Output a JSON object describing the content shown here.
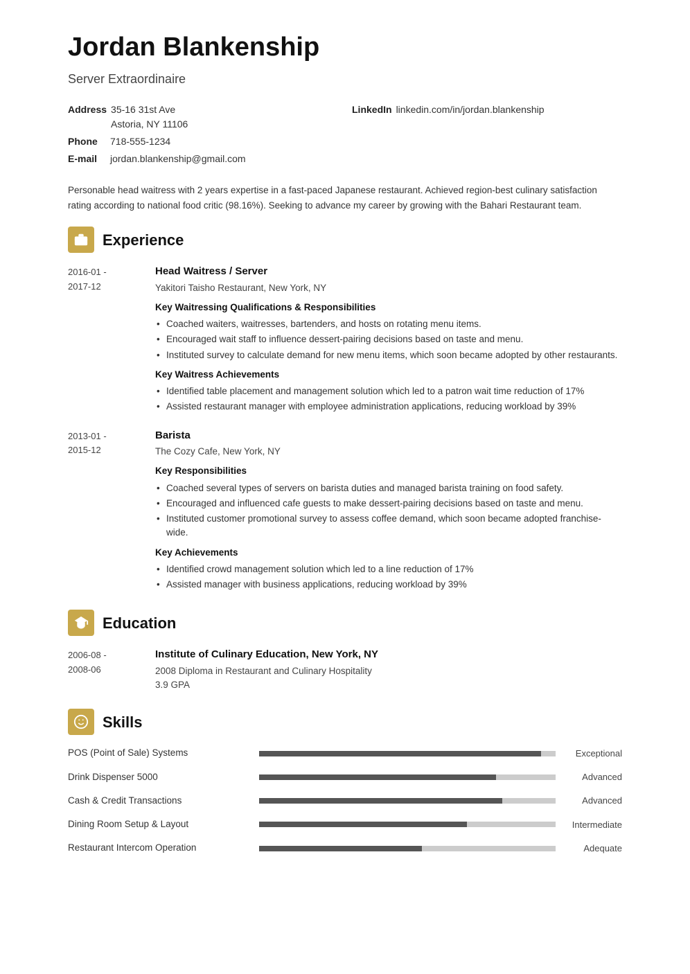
{
  "header": {
    "name": "Jordan Blankenship",
    "title": "Server Extraordinaire"
  },
  "contact": {
    "address_label": "Address",
    "address_line1": "35-16 31st Ave",
    "address_line2": "Astoria, NY 11106",
    "phone_label": "Phone",
    "phone": "718-555-1234",
    "email_label": "E-mail",
    "email": "jordan.blankenship@gmail.com",
    "linkedin_label": "LinkedIn",
    "linkedin": "linkedin.com/in/jordan.blankenship"
  },
  "summary": "Personable head waitress with 2 years expertise in a fast-paced Japanese restaurant. Achieved region-best culinary satisfaction rating according to national food critic (98.16%). Seeking to advance my career by growing with the Bahari Restaurant team.",
  "experience_title": "Experience",
  "experience": [
    {
      "dates": "2016-01 -\n2017-12",
      "title": "Head Waitress / Server",
      "subtitle": "Yakitori Taisho Restaurant, New York, NY",
      "sub_sections": [
        {
          "heading": "Key Waitressing Qualifications & Responsibilities",
          "bullets": [
            "Coached waiters, waitresses, bartenders, and hosts on rotating menu items.",
            "Encouraged wait staff to influence dessert-pairing decisions based on taste and menu.",
            "Instituted survey to calculate demand for new menu items, which soon became adopted by other restaurants."
          ]
        },
        {
          "heading": "Key Waitress Achievements",
          "bullets": [
            "Identified table placement and management solution which led to a patron wait time reduction of 17%",
            "Assisted restaurant manager with employee administration applications, reducing workload by 39%"
          ]
        }
      ]
    },
    {
      "dates": "2013-01 -\n2015-12",
      "title": "Barista",
      "subtitle": "The Cozy Cafe, New York, NY",
      "sub_sections": [
        {
          "heading": "Key Responsibilities",
          "bullets": [
            "Coached several types of servers on barista duties and managed barista training on food safety.",
            "Encouraged and influenced cafe guests to make dessert-pairing decisions based on taste and menu.",
            "Instituted customer promotional survey to assess coffee demand, which soon became adopted franchise-wide."
          ]
        },
        {
          "heading": "Key Achievements",
          "bullets": [
            "Identified crowd management solution which led to a line reduction of 17%",
            "Assisted manager with business applications, reducing workload by 39%"
          ]
        }
      ]
    }
  ],
  "education_title": "Education",
  "education": [
    {
      "dates": "2006-08 -\n2008-06",
      "institution": "Institute of Culinary Education, New York, NY",
      "degree": "2008 Diploma in Restaurant and Culinary Hospitality",
      "gpa": "3.9 GPA"
    }
  ],
  "skills_title": "Skills",
  "skills": [
    {
      "name": "POS (Point of Sale) Systems",
      "level": "Exceptional",
      "percent": 95
    },
    {
      "name": "Drink Dispenser 5000",
      "level": "Advanced",
      "percent": 80
    },
    {
      "name": "Cash & Credit Transactions",
      "level": "Advanced",
      "percent": 82
    },
    {
      "name": "Dining Room Setup & Layout",
      "level": "Intermediate",
      "percent": 70
    },
    {
      "name": "Restaurant Intercom Operation",
      "level": "Adequate",
      "percent": 55
    }
  ]
}
